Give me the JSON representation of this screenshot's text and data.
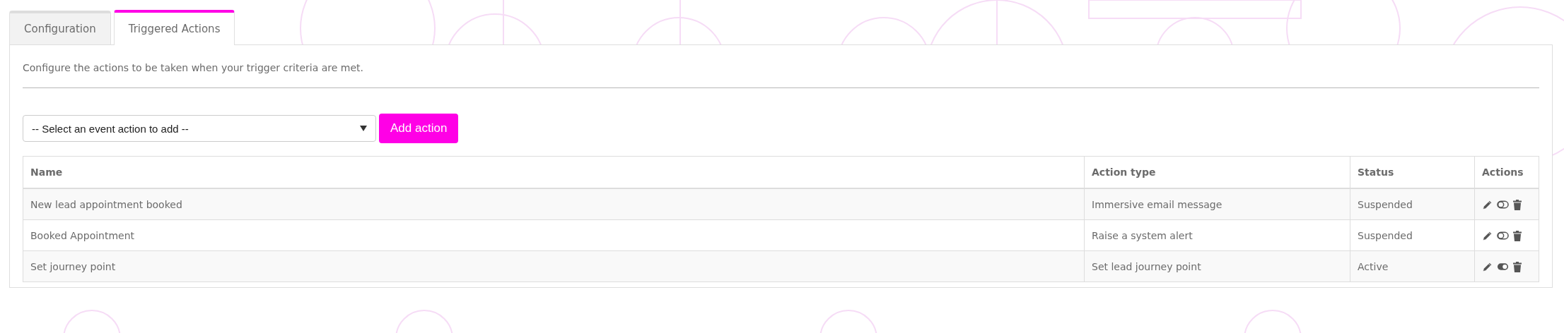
{
  "tabs": [
    {
      "label": "Configuration",
      "selected": false
    },
    {
      "label": "Triggered Actions",
      "selected": true
    }
  ],
  "description": "Configure the actions to be taken when your trigger criteria are met.",
  "event_select": {
    "placeholder": "-- Select an event action to add --"
  },
  "add_button": "Add action",
  "table": {
    "columns": [
      "Name",
      "Action type",
      "Status",
      "Actions"
    ],
    "rows": [
      {
        "name": "New lead appointment booked",
        "action_type": "Immersive email message",
        "status": "Suspended",
        "enabled": false
      },
      {
        "name": "Booked Appointment",
        "action_type": "Raise a system alert",
        "status": "Suspended",
        "enabled": false
      },
      {
        "name": "Set journey point",
        "action_type": "Set lead journey point",
        "status": "Active",
        "enabled": true
      }
    ]
  }
}
